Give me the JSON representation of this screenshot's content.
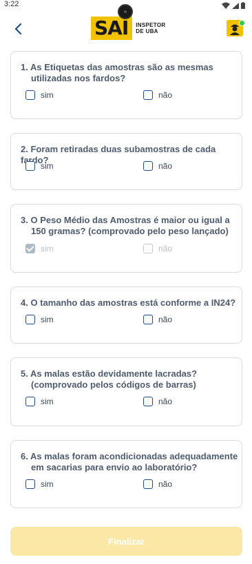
{
  "status_bar": {
    "time": "3:22"
  },
  "header": {
    "logo_main": "SAI",
    "logo_sub_line1": "INSPETOR",
    "logo_sub_line2": "DE UBA"
  },
  "questions": [
    {
      "number": "1.",
      "line1": "As Etiquetas das amostras são as mesmas",
      "line2": "utilizadas nos fardos?",
      "yes": "sim",
      "no": "não",
      "yes_checked": false,
      "disabled": false
    },
    {
      "number": "2.",
      "line1": "Foram retiradas duas subamostras de cada fardo?",
      "line2": "",
      "yes": "sim",
      "no": "não",
      "yes_checked": false,
      "disabled": false
    },
    {
      "number": "3.",
      "line1": "O Peso Médio das Amostras é maior ou igual a",
      "line2": "150 gramas? (comprovado pelo peso lançado)",
      "yes": "sim",
      "no": "não",
      "yes_checked": true,
      "disabled": true
    },
    {
      "number": "4.",
      "line1": "O tamanho das amostras está conforme a IN24?",
      "line2": "",
      "yes": "sim",
      "no": "não",
      "yes_checked": false,
      "disabled": false
    },
    {
      "number": "5.",
      "line1": "As malas estão devidamente lacradas?",
      "line2": "(comprovado pelos códigos de barras)",
      "yes": "sim",
      "no": "não",
      "yes_checked": false,
      "disabled": false
    },
    {
      "number": "6.",
      "line1": "As malas foram acondicionadas adequadamente",
      "line2": "em sacarias para envio ao laboratório?",
      "yes": "sim",
      "no": "não",
      "yes_checked": false,
      "disabled": false
    }
  ],
  "footer": {
    "finalize_label": "Finalizar"
  },
  "colors": {
    "brand": "#f2c200",
    "checkbox_border": "#1e4f8c",
    "button_disabled": "#fbe8a6"
  }
}
